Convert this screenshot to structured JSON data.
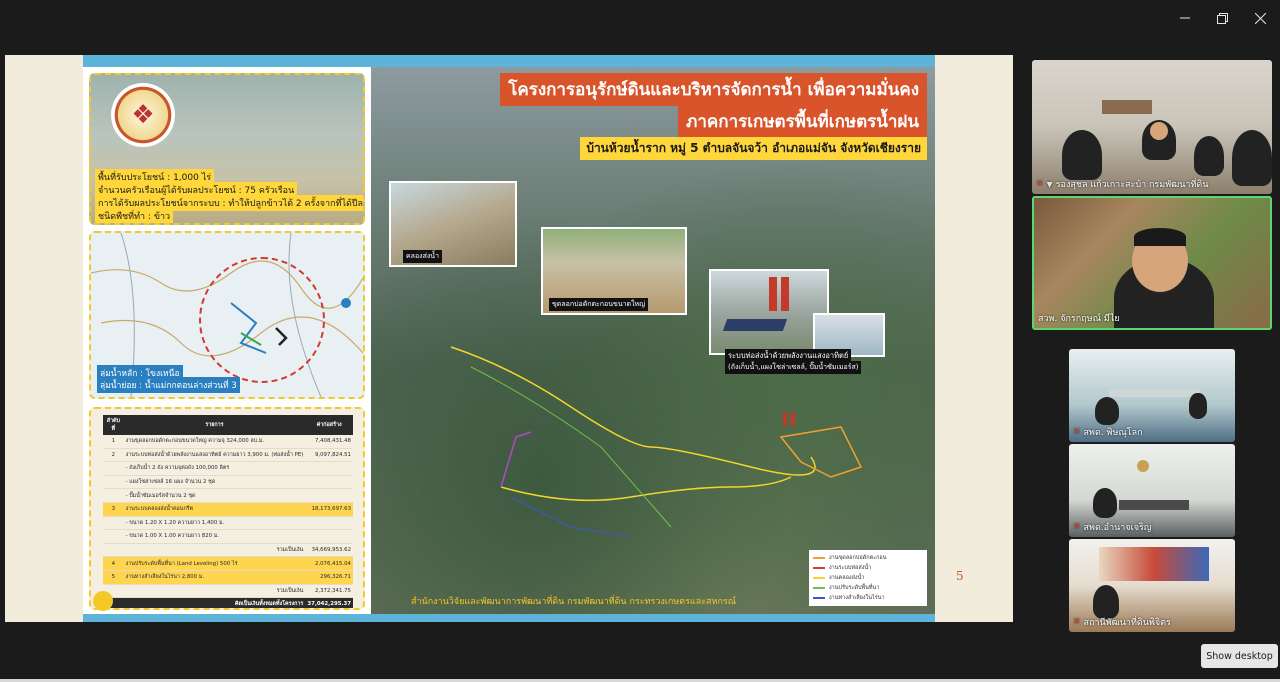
{
  "window": {
    "controls": [
      "minimize-icon",
      "maximize-icon",
      "close-icon"
    ]
  },
  "slide": {
    "title_line1": "โครงการอนุรักษ์ดินและบริหารจัดการน้ำ เพื่อความมั่นคง",
    "title_line2": "ภาคการเกษตรพื้นที่เกษตรน้ำฝน",
    "subtitle": "บ้านห้วยน้ำราก หมู่ 5 ตำบลจันจว้า อำเภอแม่จัน จังหวัดเชียงราย",
    "info": [
      "พื้นที่รับประโยชน์ : 1,000 ไร่",
      "จำนวนครัวเรือนผู้ได้รับผลประโยชน์ : 75 ครัวเรือน",
      "การได้รับผลประโยชน์จากระบบ : ทำให้ปลูกข้าวได้ 2 ครั้งจากที่ได้ปีละครั้ง",
      "ชนิดพืชที่ทำ : ข้าว"
    ],
    "basin": [
      "ลุ่มน้ำหลัก : โขงเหนือ",
      "ลุ่มน้ำย่อย : น้ำแม่กกตอนล่างส่วนที่ 3"
    ],
    "photo_captions": {
      "canal": "คลองส่งน้ำ",
      "pond": "ขุดลอกบ่อดักตะกอนขนาดใหญ่",
      "solar": "ระบบท่อส่งน้ำด้วยพลังงานแสงอาทิตย์",
      "solar_sub": "(ถังเก็บน้ำ,แผงโซล่าเซลล์, ปั๊มน้ำซัมเมอร์ส)"
    },
    "table": {
      "headers": [
        "ลำดับที่",
        "รายการ",
        "ค่าก่อสร้าง"
      ],
      "rows": [
        {
          "no": "1",
          "item": "งานขุดลอกบ่อดักตะกอนขนาดใหญ่ ความจุ 324,000 ลบ.ม.",
          "cost": "7,408,431.48",
          "hl": false
        },
        {
          "no": "2",
          "item": "งานระบบท่อส่งน้ำด้วยพลังงานแสงอาทิตย์ ความยาว 3,900 ม. (ท่อส่งน้ำ PE)",
          "cost": "9,097,824.51",
          "hl": false
        },
        {
          "no": "",
          "item": "- ถังเก็บน้ำ 2 ถัง ความจุต่อถัง 100,000 ลิตร",
          "cost": "",
          "hl": false
        },
        {
          "no": "",
          "item": "- แผงโซล่าเซลล์ 16 แผง จำนวน 2 ชุด",
          "cost": "",
          "hl": false
        },
        {
          "no": "",
          "item": "- ปั๊มน้ำซัมเมอร์สจำนวน 2 ชุด",
          "cost": "",
          "hl": false
        },
        {
          "no": "3",
          "item": "งานระบบคลองส่งน้ำคอนกรีต",
          "cost": "18,173,697.63",
          "hl": true
        },
        {
          "no": "",
          "item": "- ขนาด 1.20 X 1.20 ความยาว 1,400 ม.",
          "cost": "",
          "hl": false
        },
        {
          "no": "",
          "item": "- ขนาด 1.00 X 1.00 ความยาว 820 ม.",
          "cost": "",
          "hl": false
        },
        {
          "no": "",
          "item": "รวมเป็นเงิน",
          "cost": "34,669,953.62",
          "hl": false,
          "sum": true
        },
        {
          "no": "4",
          "item": "งานปรับระดับพื้นที่นา (Land Leveling) 500 ไร่",
          "cost": "2,076,415.04",
          "hl": true
        },
        {
          "no": "5",
          "item": "งานทางลำเลียงในไร่นา 2,800 ม.",
          "cost": "296,326.71",
          "hl": true
        },
        {
          "no": "",
          "item": "รวมเป็นเงิน",
          "cost": "2,372,341.75",
          "hl": false,
          "sum": true
        }
      ],
      "total_label": "คิดเป็นเงินทั้งหมดทั้งโครงการ",
      "total_value": "37,042,295.37"
    },
    "legend": [
      {
        "label": "งานขุดลอกบ่อดักตะกอน",
        "color": "#f0a030"
      },
      {
        "label": "งานระบบท่อส่งน้ำ",
        "color": "#e03b2f"
      },
      {
        "label": "งานคลองส่งน้ำ",
        "color": "#f2d62e"
      },
      {
        "label": "งานปรับระดับพื้นที่นา",
        "color": "#6fc24a"
      },
      {
        "label": "งานทางลำเลียงในไร่นา",
        "color": "#3d56c8"
      }
    ],
    "footer": "สำนักงานวิจัยและพัฒนาการพัฒนาที่ดิน กรมพัฒนาที่ดิน กระทรวงเกษตรและสหกรณ์",
    "page_number": "5"
  },
  "participants": [
    {
      "name": "รองสุชล แก้วเกาะสะบ้า กรมพัฒนาที่ดิน",
      "muted": true,
      "pinned": true
    },
    {
      "name": "สวพ. จักรกฤษณ์ มีไย",
      "muted": false,
      "pinned": false,
      "speaking": true
    },
    {
      "name": "สพด. พิษณุโลก",
      "muted": true,
      "pinned": false
    },
    {
      "name": "สพด.อำนาจเจริญ",
      "muted": true,
      "pinned": false
    },
    {
      "name": "สถานีพัฒนาที่ดินพิจิตร",
      "muted": true,
      "pinned": false
    }
  ],
  "show_desktop": "Show desktop"
}
